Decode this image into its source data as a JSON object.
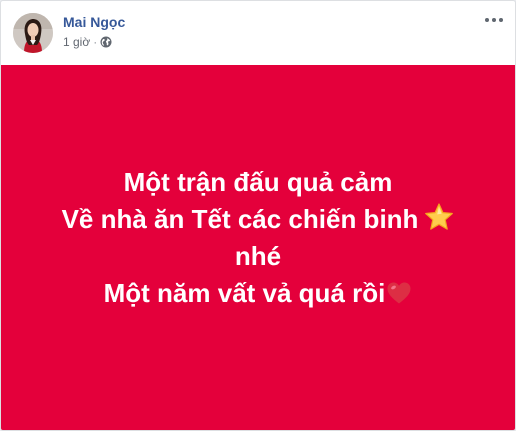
{
  "post": {
    "author_name": "Mai Ngọc",
    "timestamp": "1 giờ",
    "separator": "·",
    "privacy_icon": "globe-icon",
    "more_icon": "more-options-icon",
    "status": {
      "background_color": "#e4003b",
      "text_color": "#ffffff",
      "lines": [
        "Một trận đấu quả cảm",
        "Về nhà ăn Tết các chiến binh",
        "nhé",
        "Một năm vất vả quá rồi"
      ],
      "emojis": [
        "star-emoji-icon",
        "red-heart-emoji-icon"
      ]
    }
  }
}
